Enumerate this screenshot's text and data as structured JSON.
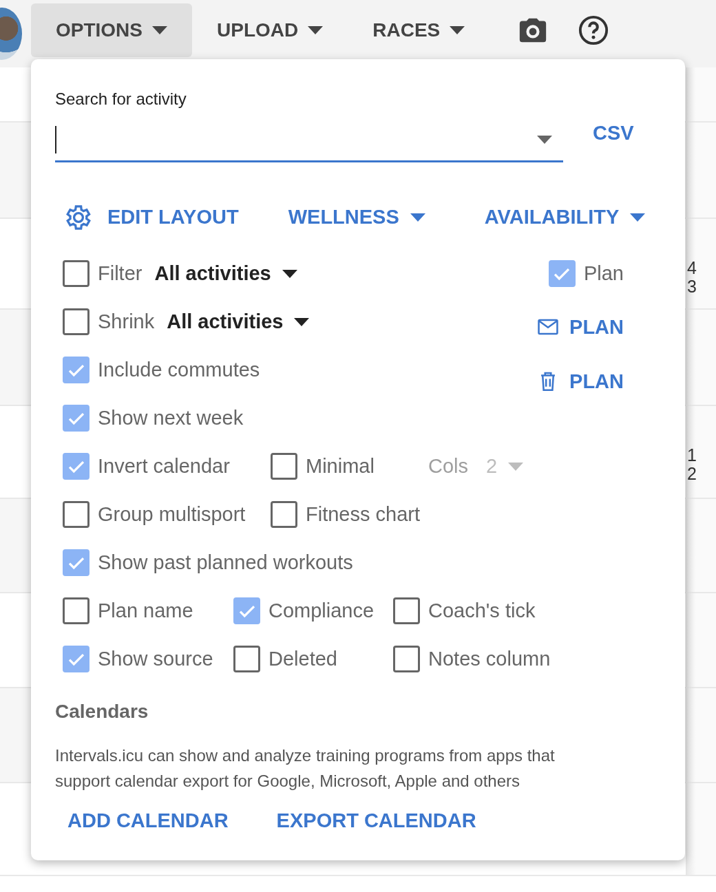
{
  "nav": [
    {
      "label": "OPTIONS",
      "selected": true
    },
    {
      "label": "UPLOAD",
      "selected": false
    },
    {
      "label": "RACES",
      "selected": false
    }
  ],
  "calendar_edge": [
    {
      "lines": [
        "4",
        "3"
      ]
    },
    {
      "lines": [
        "1",
        "2"
      ]
    }
  ],
  "options": {
    "search": {
      "label": "Search for activity",
      "link": "CSV"
    },
    "actions": [
      {
        "kind": "gear",
        "label": "EDIT LAYOUT"
      },
      {
        "kind": "dropdown",
        "label": "WELLNESS"
      },
      {
        "kind": "dropdown",
        "label": "AVAILABILITY"
      }
    ],
    "rows": [
      {
        "items": [
          {
            "kind": "checkbox",
            "label": "Filter",
            "checked": false
          },
          {
            "kind": "select",
            "value": "All activities",
            "disabled": false
          }
        ],
        "side": {
          "kind": "checkbox",
          "label": "Plan",
          "checked": true
        }
      },
      {
        "items": [
          {
            "kind": "checkbox",
            "label": "Shrink",
            "checked": false
          },
          {
            "kind": "select",
            "value": "All activities",
            "disabled": false
          }
        ],
        "side": {
          "kind": "mail-button",
          "label": "PLAN"
        }
      },
      {
        "items": [
          {
            "kind": "checkbox",
            "label": "Include commutes",
            "checked": true
          }
        ],
        "side": {
          "kind": "trash-button",
          "label": "PLAN"
        }
      },
      {
        "items": [
          {
            "kind": "checkbox",
            "label": "Show next week",
            "checked": true
          }
        ]
      },
      {
        "items": [
          {
            "kind": "checkbox",
            "label": "Invert calendar",
            "checked": true
          },
          {
            "kind": "checkbox",
            "label": "Minimal",
            "checked": false
          },
          {
            "kind": "select",
            "label": "Cols",
            "value": "2",
            "disabled": true
          }
        ]
      },
      {
        "items": [
          {
            "kind": "checkbox",
            "label": "Group multisport",
            "checked": false
          },
          {
            "kind": "checkbox",
            "label": "Fitness chart",
            "checked": false
          }
        ]
      },
      {
        "items": [
          {
            "kind": "checkbox",
            "label": "Show past planned workouts",
            "checked": true
          }
        ]
      },
      {
        "items": [
          {
            "kind": "checkbox",
            "label": "Plan name",
            "checked": false
          },
          {
            "kind": "checkbox",
            "label": "Compliance",
            "checked": true
          },
          {
            "kind": "checkbox",
            "label": "Coach's tick",
            "checked": false
          }
        ]
      },
      {
        "items": [
          {
            "kind": "checkbox",
            "label": "Show source",
            "checked": true
          },
          {
            "kind": "checkbox",
            "label": "Deleted",
            "checked": false
          },
          {
            "kind": "checkbox",
            "label": "Notes column",
            "checked": false
          }
        ]
      }
    ],
    "calendars": {
      "title": "Calendars",
      "description": "Intervals.icu can show and analyze training programs from apps that support calendar export for Google, Microsoft, Apple and others",
      "links": [
        "ADD CALENDAR",
        "EXPORT CALENDAR"
      ]
    }
  }
}
